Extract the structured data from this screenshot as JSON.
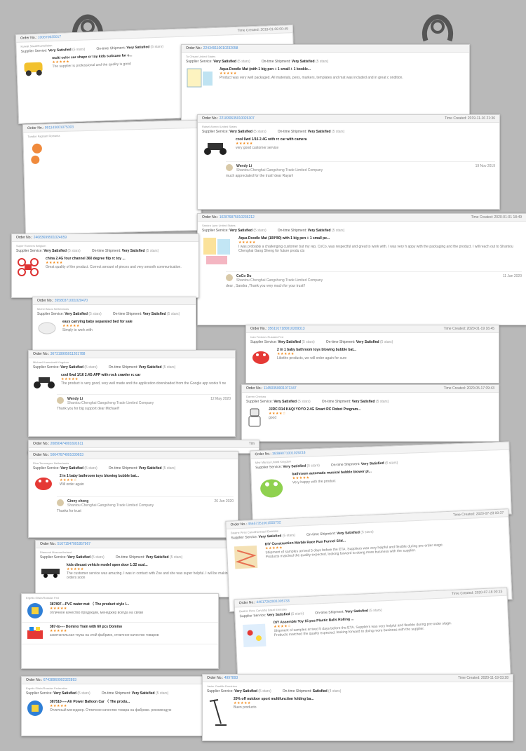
{
  "labels": {
    "order": "Order No.:",
    "supplier_service": "Supplier Service:",
    "ontime": "On-time Shipment:",
    "time_created": "Time Created:"
  },
  "cards": {
    "c1": {
      "order": "100870635017",
      "time": "Time Created: 2019-01-08 00:49",
      "sub": "Kuwait Saudi/Kuwaitiston",
      "svc": "Very Satisfied",
      "svc_st": "(5 stars)",
      "ship": "Very Satisfied",
      "ship_st": "(5 stars)",
      "title": "multi color car shape cr toy kids suitcase for c...",
      "stars": "★★★★★",
      "text": "The supplier is professional and the quality is good"
    },
    "c2": {
      "order": "224349110010232058",
      "sub": "To Ohsan United States",
      "svc": "Very Satisfied",
      "svc_st": "(5 stars)",
      "ship": "Very Satisfied",
      "ship_st": "(5 stars)",
      "title": "Aqua Doodle Mat (with 1 big pen + 1 small + 1 bookle...",
      "stars": "★★★★★",
      "text": "Product was very well packaged. All materials, pens, markers, templates and mat was included and in great c ondition."
    },
    "c3": {
      "order": "991143001075303",
      "sub": "Tandon Fagbam Romania"
    },
    "c4": {
      "order": "221830635010026307",
      "time": "Time Created: 2019-11-16 21:36",
      "sub": "Raisel Ahmed United States",
      "svc": "Very Satisfied",
      "svc_st": "(5 stars)",
      "ship": "Very Satisfied",
      "ship_st": "(5 stars)",
      "title": "cool 6wd 1/16 2.4G with rc car with camera",
      "stars": "★★★★★",
      "text": "very good customer service",
      "reply_name": "Wendy Li",
      "reply_co": "Shantou Chenghai Gangsheng Trade Limited Company",
      "reply_date": "19 Nov 2019",
      "reply_msg": "much appreciated for the trust! dear Rayan!"
    },
    "c5": {
      "order": "102876875010236212",
      "time": "Time Created: 2020-01-01 18:49",
      "sub": "Sandra Lynn United States",
      "svc": "Very Satisfied",
      "svc_st": "(5 stars)",
      "ship": "Very Satisfied",
      "ship_st": "(5 stars)",
      "title": "Aqua Doodle Mat (100*80) with 1 big pen + 1 small pe...",
      "stars": "★★★★★",
      "text": "I was probably a challenging customer but my rep, CoCo, was respectful and great to work with. I was very h appy with the packaging and the product. I will reach out to Shantou Chenghai Gang Sheng for future produ cts",
      "reply_name": "CoCo Du",
      "reply_co": "Shantou Chenghai Gangsheng Trade Limited Company",
      "reply_date": "11 Jan 2020",
      "reply_msg": "dear , Sandra ,Thank you very much for your trust!!"
    },
    "c6": {
      "order": "24683699501024659",
      "sub": "Super Runners Belgium",
      "svc": "Very Satisfied",
      "svc_st": "(5 stars)",
      "ship": "Very Satisfied",
      "ship_st": "(5 stars)",
      "title": "china 2.4G four channel 360 degree flip rc toy ...",
      "stars": "★★★★★",
      "text": "Great quality of the product. Correct amount of pieces and very smooth communication."
    },
    "c7": {
      "order": "39580371001020470",
      "sub": "Michel Muus Netherlands",
      "svc": "Very Satisfied",
      "svc_st": "(5 stars)",
      "ship": "Very Satisfied",
      "ship_st": "(5 stars)",
      "title": "easy carrying baby separated bed for sale",
      "stars": "★★★★★",
      "text": "Simply to work with"
    },
    "c8": {
      "order": "3561917180010209313",
      "time": "Time Created: 2020-01-19 16:45",
      "sub": "Ivan Fedorov Russian Fed",
      "svc": "Very Satisfied",
      "svc_st": "(5 stars)",
      "ship": "Very Satisfied",
      "ship_st": "(5 stars)",
      "title": "2 in 1 baby bathroom toys blowing bubble bat...",
      "stars": "★★★★★",
      "text": "Likethe products, we will order again for sure"
    },
    "c9": {
      "order": "367319905011201788",
      "sub": "Michael Kamminett Kingdom",
      "svc": "Very Satisfied",
      "svc_st": "(5 stars)",
      "ship": "Very Satisfied",
      "ship_st": "(5 stars)",
      "title": "cool 6wd 1/16 2.4G APP with rock crawler rc car",
      "stars": "★★★★★",
      "text": "The product is very good, very well made and the application downloaded from the Google app works fi ne",
      "reply_name": "Wendy Li",
      "reply_co": "Shantou Chenghai Gangsheng Trade Limited Company",
      "reply_date": "12 May 2020",
      "reply_msg": "Thank you for big support dear Michael!!"
    },
    "c10": {
      "order": "11450350001071347",
      "time": "Time Created: 2020-05-17 09:43",
      "sub": "Darren Chelsea",
      "svc": "Very Satisfied",
      "svc_st": "(5 stars)",
      "ship": "Very Satisfied",
      "ship_st": "(5 stars)",
      "title": "JJRC R14 KAQI YOYO 2.4G Smart RC Robot Program...",
      "stars": "★★★★☆",
      "text": "good"
    },
    "c11": {
      "order": "20890474001691611",
      "time": "Tim"
    },
    "c12": {
      "order": "50647674001030653",
      "sub": "Rica Temmeyee Netherlands",
      "svc": "Very Satisfied",
      "svc_st": "(5 stars)",
      "ship": "Very Satisfied",
      "ship_st": "(5 stars)",
      "title": "2 in 1 baby bathroom toys blowing bubble bat...",
      "stars": "★★★★☆",
      "text": "Will order again",
      "reply_name": "Ginny cheng",
      "reply_co": "Shantou Chenghai Gangsheng Trade Limited Company",
      "reply_date": "26 Jun 2020",
      "reply_msg": "Thanks for trust"
    },
    "c13": {
      "order": "38399071001029218",
      "sub": "Mhir Mansai United Kingdom",
      "svc": "Very Satisfied",
      "svc_st": "(5 stars)",
      "ship": "Very Satisfied",
      "ship_st": "(5 stars)",
      "title": "bathroom automatic musical bubble blower pl...",
      "stars": "★★★★★",
      "text": "Very happy with the product"
    },
    "c14": {
      "order": "51671547001857967",
      "sub": "Diamond Moscow/Ireland",
      "svc": "Very Satisfied",
      "svc_st": "(5 stars)",
      "ship": "Very Satisfied",
      "ship_st": "(5 stars)",
      "title": "kids diecast vehicle model open door 1:32 scal...",
      "stars": "★★★★★",
      "text": "The customer service was amazing. I was in contact with Zoe and she was super helpful. I will be making more orders soon"
    },
    "c15": {
      "order": "45657351001555732",
      "time": "Time Created: 2020-07-23 00:37",
      "sub": "Beatriz Pires Carvalho Brazil Emirates",
      "svc": "Very Satisfied",
      "svc_st": "(5 stars)",
      "ship": "Very Satisfied",
      "ship_st": "(5 stars)",
      "title": "DIY Construction Marble Race Run Funnel Slid...",
      "stars": "★★★★★",
      "text": "Shipment of samples arrived 5 days before the ETA. Suppliers was very helpful and flexible during pre-order stage.",
      "text2": "Products matched the quality expected, looking forward to doing more business with the supplier."
    },
    "c16": {
      "sub": "Ergetic Eltsin/Russian Fed",
      "items": [
        {
          "title": "387897---PVC water mat （ The product style l...",
          "stars": "★★★★★",
          "text": "отличное качество продукции, менеджер всегда на связи"
        },
        {
          "title": "387-to---- Domino Train with 60 pcs Domino",
          "stars": "★★★★★",
          "text": "замечательная тоука на этой фабрике, отличное качество товаров"
        }
      ]
    },
    "c17": {
      "order": "44617262001005733",
      "time": "Time Created: 2020-07-18 00:15",
      "sub": "Beatriz Pires Carvalho Brazil Emirates",
      "svc": "Very Satisfied",
      "svc_st": "(5 stars)",
      "ship": "Very Satisfied",
      "ship_st": "(5 stars)",
      "title": "DIY Assemble Toy 15 pcs Plastic Balls Rolling ...",
      "stars": "★★★★☆",
      "text": "Shipment of samples arrived 5 days before the ETA. Suppliers was very helpful and flexible during pre-order stage.",
      "text2": "Products matched the quality expected, looking forward to doing more business with the supplier."
    },
    "c18": {
      "order": "67438960902322893",
      "sub": "Ergetic Eltsin/Russian Federation",
      "svc": "Very Satisfied",
      "svc_st": "(5 stars)",
      "ship": "Very Satisfied",
      "ship_st": "(5 stars)",
      "title": "387510-----Air Power Balloon Car （ The produ...",
      "stars": "★★★★★",
      "text": "Отличный менеджер. Отличное качество товара на фабрике. рекомендую"
    },
    "c19": {
      "order": "4997893",
      "time": "Time Created: 2020-11-19 03:28",
      "sub": "Javier Castillo Dominica",
      "svc": "Very Satisfied",
      "svc_st": "(5 stars)",
      "ship": "Satisfied",
      "ship_st": "(4 stars)",
      "title": "20% off outdoor sport multifunction folding ba...",
      "stars": "★★★★★",
      "text": "Buen producto"
    }
  },
  "icons": {
    "clip": "binder-clip-icon",
    "avatar": "avatar-icon"
  },
  "colors": {
    "accent": "#4a90d9",
    "star": "#f28c1e"
  }
}
